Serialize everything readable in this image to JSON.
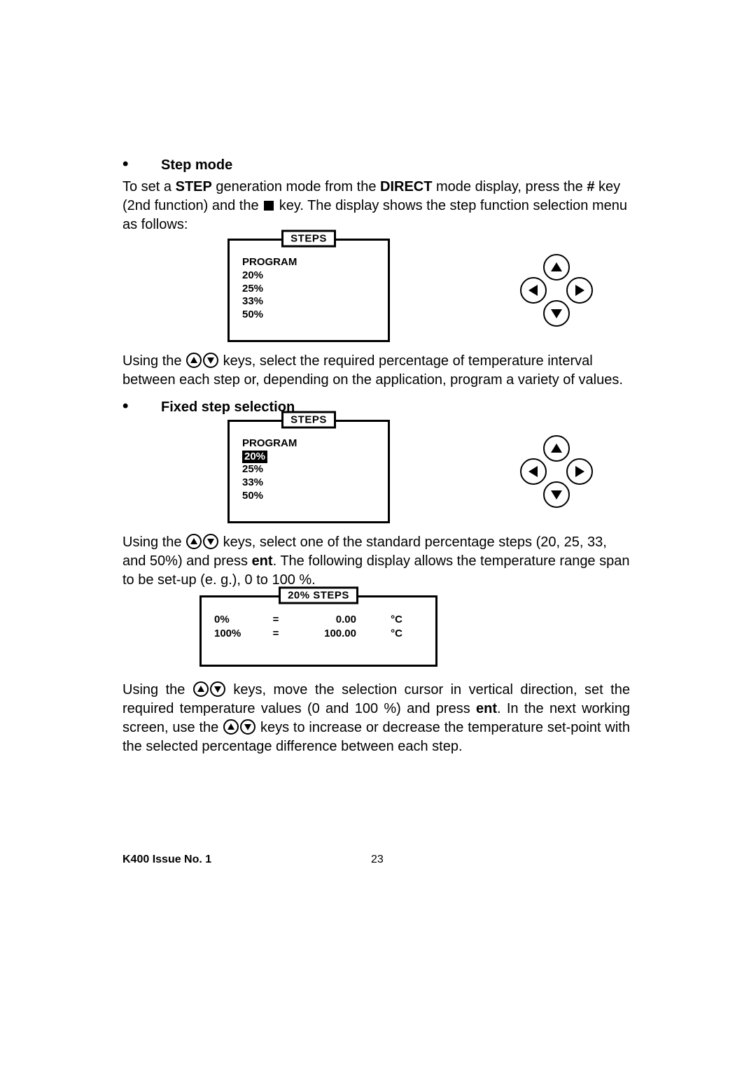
{
  "sections": {
    "stepMode": {
      "heading": "Step mode",
      "paraPrefix": "To set a ",
      "kwStep": "STEP",
      "paraMid1": " generation mode from the ",
      "kwDirect": "DIRECT",
      "paraMid2": " mode display, press the ",
      "kwHash": "#",
      "paraMid3": " key (2nd function) and the ",
      "paraEnd": " key.  The display shows the step function selection menu as follows:"
    },
    "lcd1": {
      "title": "STEPS",
      "items": [
        "PROGRAM",
        "20%",
        "25%",
        "33%",
        "50%"
      ]
    },
    "afterLcd1": {
      "prefix": "Using the ",
      "rest": " keys, select the required percentage of temperature interval between each step or, depending on the application, program a variety of values."
    },
    "fixedStep": {
      "heading": "Fixed step selection"
    },
    "lcd2": {
      "title": "STEPS",
      "items": [
        "PROGRAM",
        "20%",
        "25%",
        "33%",
        "50%"
      ],
      "highlightIndex": 1
    },
    "afterLcd2": {
      "prefix": "Using the ",
      "mid1": " keys, select one of the standard percentage steps (20, 25, 33, and 50%) and press ",
      "kwEnt": "ent",
      "mid2": ".  The following display allows the temperature range span to be set-up (e. g.), 0 to 100 %."
    },
    "lcd3": {
      "title": "20% STEPS",
      "rows": [
        {
          "label": "0%",
          "eq": "=",
          "value": "0.00",
          "unit": "°C"
        },
        {
          "label": "100%",
          "eq": "=",
          "value": "100.00",
          "unit": "°C"
        }
      ]
    },
    "afterLcd3": {
      "prefix": "Using the ",
      "mid1": " keys, move the selection cursor in vertical direction, set the required temperature values (0 and 100 %) and press ",
      "kwEnt": "ent",
      "mid2": ".  In the next working screen, use the ",
      "mid3": " keys to increase or decrease the temperature set-point with the selected percentage difference between each step."
    }
  },
  "footer": {
    "left": "K400 Issue No. 1",
    "page": "23"
  }
}
